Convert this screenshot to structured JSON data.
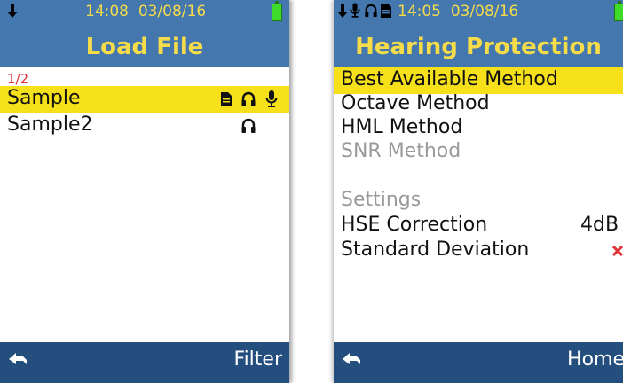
{
  "left_screen": {
    "time": "14:08",
    "date": "03/08/16",
    "title": "Load File",
    "page_count": "1/2",
    "files": [
      {
        "name": "Sample",
        "selected": true,
        "icons": [
          "document-icon",
          "headphones-icon",
          "microphone-icon"
        ]
      },
      {
        "name": "Sample2",
        "selected": false,
        "icons": [
          "headphones-icon"
        ]
      }
    ],
    "footer_right": "Filter"
  },
  "right_screen": {
    "time": "14:05",
    "date": "03/08/16",
    "title": "Hearing Protection",
    "menu": [
      {
        "label": "Best Available Method",
        "selected": true,
        "enabled": true
      },
      {
        "label": "Octave Method",
        "selected": false,
        "enabled": true
      },
      {
        "label": "HML Method",
        "selected": false,
        "enabled": true
      },
      {
        "label": "SNR Method",
        "selected": false,
        "enabled": false
      }
    ],
    "settings_heading": "Settings",
    "settings": [
      {
        "label": "HSE Correction",
        "value": "4dB"
      },
      {
        "label": "Standard Deviation",
        "value_icon": "cross-icon"
      }
    ],
    "footer_right": "Home"
  },
  "colors": {
    "header_blue": "#4377ad",
    "footer_blue": "#234e7e",
    "title_yellow": "#f7dc4a",
    "highlight_yellow": "#f6e01a",
    "battery_green": "#3fdb2a",
    "page_count_red": "#e0343a",
    "cross_red": "#e0343a"
  }
}
